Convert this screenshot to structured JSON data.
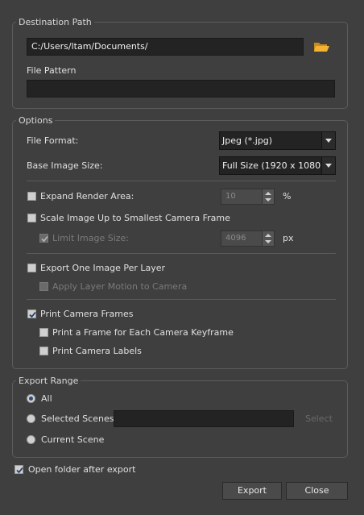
{
  "destination": {
    "title": "Destination Path",
    "path_value": "C:/Users/ltam/Documents/",
    "file_pattern_label": "File Pattern",
    "file_pattern_value": ""
  },
  "options": {
    "title": "Options",
    "file_format_label": "File Format:",
    "file_format_value": "Jpeg (*.jpg)",
    "base_image_size_label": "Base Image Size:",
    "base_image_size_value": "Full Size (1920 x 1080)",
    "expand_render_area_label": "Expand Render Area:",
    "expand_render_area_checked": false,
    "expand_value": "10",
    "expand_unit": "%",
    "scale_image_label": "Scale Image Up to Smallest Camera Frame",
    "scale_image_checked": false,
    "limit_image_size_label": "Limit Image Size:",
    "limit_image_size_checked": true,
    "limit_value": "4096",
    "limit_unit": "px",
    "export_one_image_label": "Export One Image Per Layer",
    "export_one_image_checked": false,
    "apply_layer_motion_label": "Apply Layer Motion to Camera",
    "apply_layer_motion_checked": false,
    "print_camera_frames_label": "Print Camera Frames",
    "print_camera_frames_checked": true,
    "print_frame_each_keyframe_label": "Print a Frame for Each Camera Keyframe",
    "print_frame_each_keyframe_checked": false,
    "print_camera_labels_label": "Print Camera Labels",
    "print_camera_labels_checked": false
  },
  "export_range": {
    "title": "Export Range",
    "all_label": "All",
    "selected_scenes_label": "Selected Scenes",
    "selected_scenes_value": "",
    "select_button": "Select",
    "current_scene_label": "Current Scene",
    "selected_option": "All"
  },
  "open_folder_label": "Open folder after export",
  "open_folder_checked": true,
  "buttons": {
    "export": "Export",
    "close": "Close"
  },
  "colors": {
    "background": "#3f3f3f",
    "field": "#232323",
    "folder_icon": "#f0b030"
  }
}
